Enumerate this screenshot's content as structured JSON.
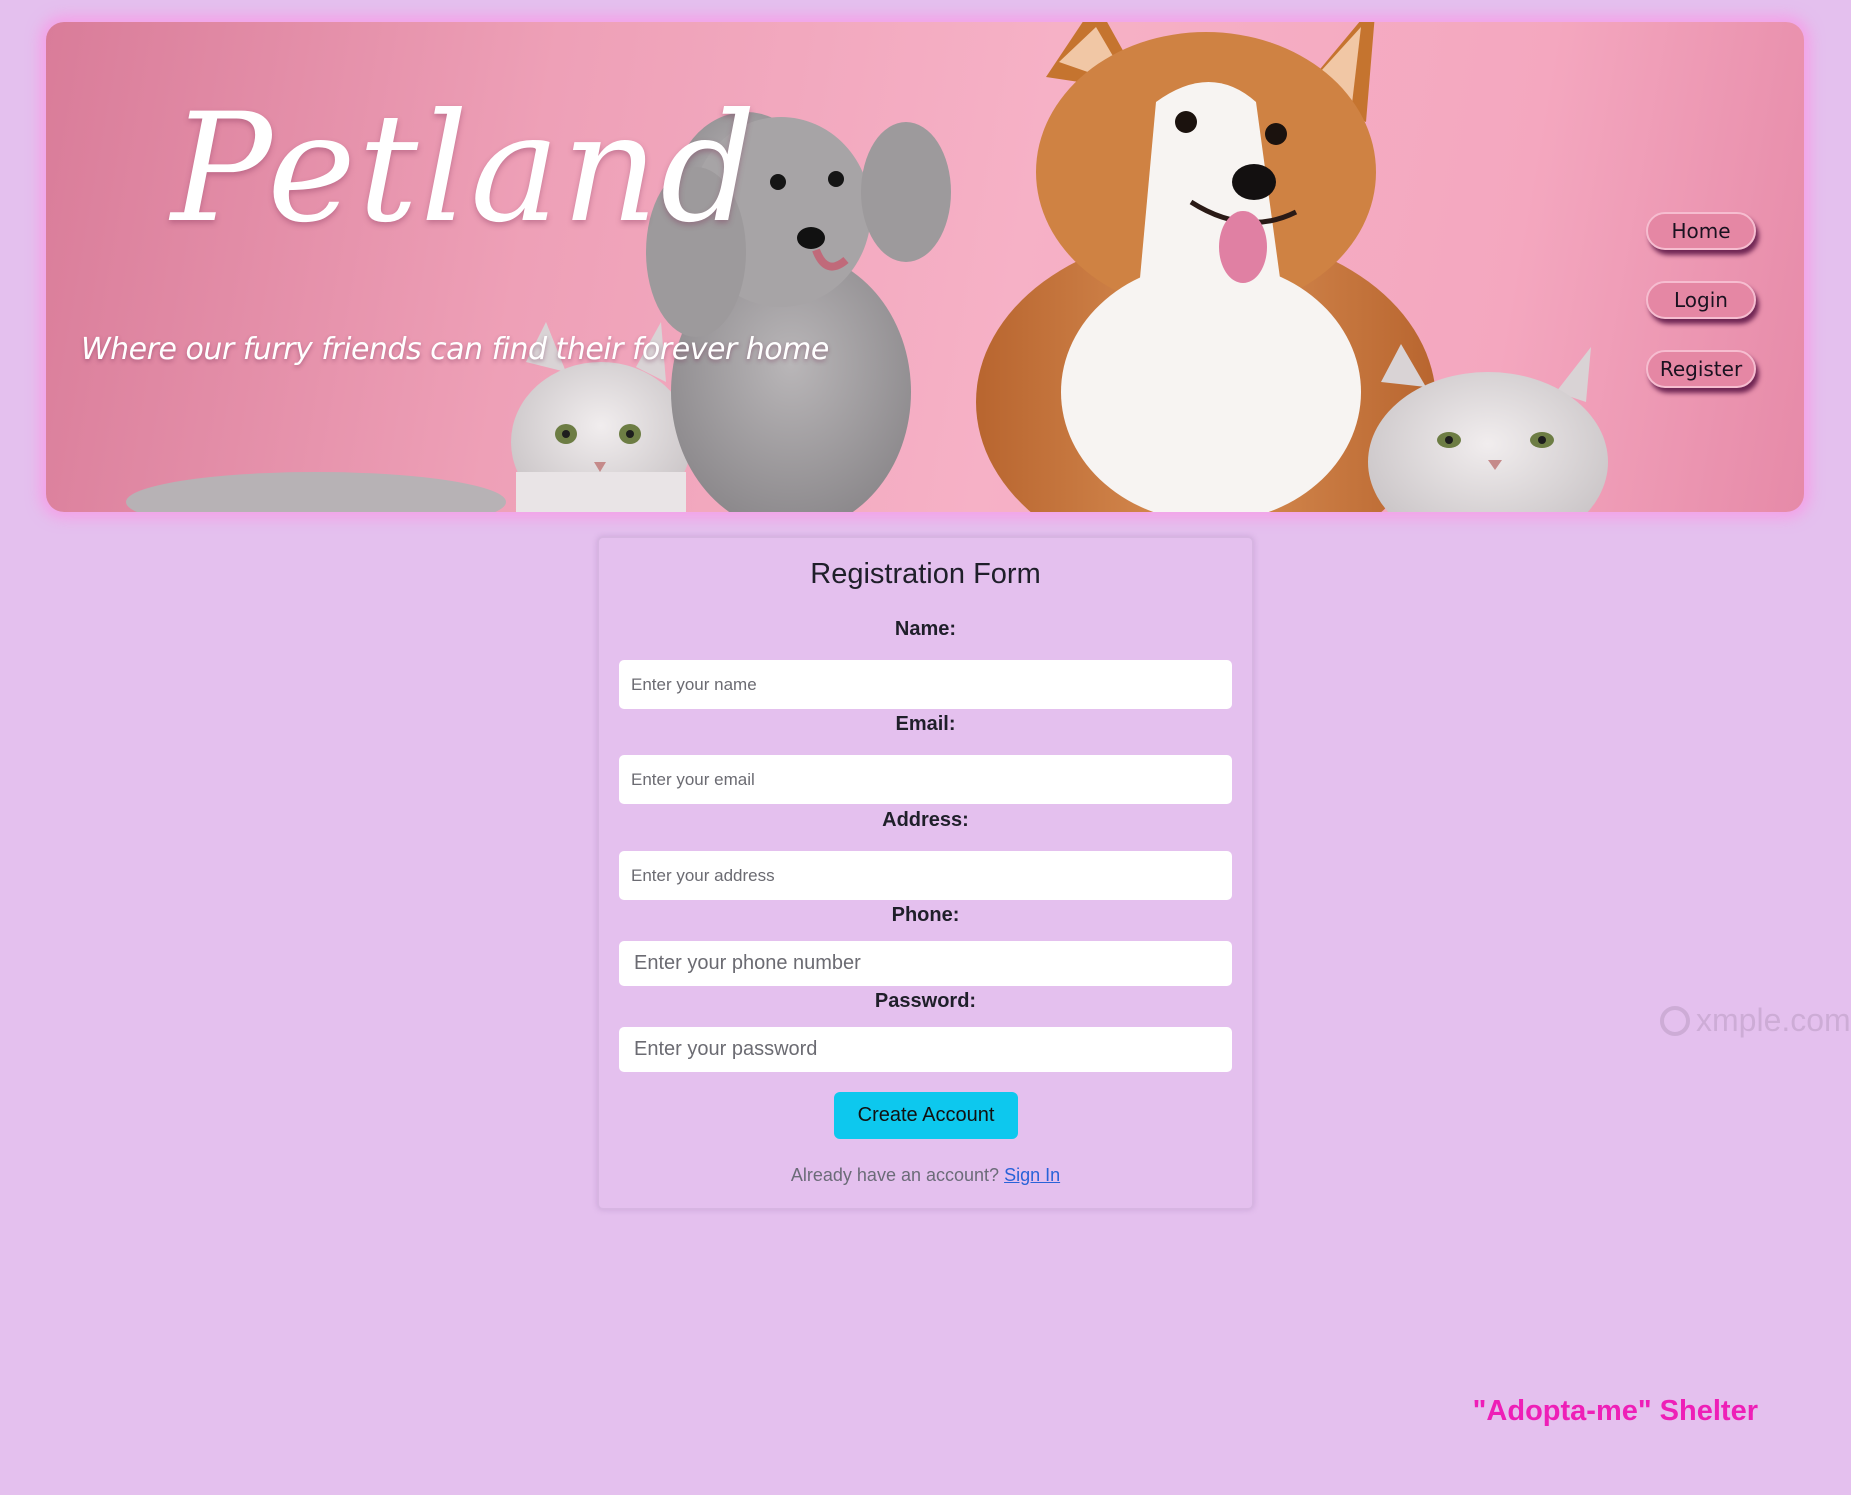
{
  "hero": {
    "title": "Petland",
    "tagline": "Where our furry friends can find their forever home"
  },
  "nav": {
    "home": "Home",
    "login": "Login",
    "register": "Register"
  },
  "form": {
    "title": "Registration Form",
    "name_label": "Name:",
    "name_placeholder": "Enter your name",
    "email_label": "Email:",
    "email_placeholder": "Enter your email",
    "address_label": "Address:",
    "address_placeholder": "Enter your address",
    "phone_label": "Phone:",
    "phone_placeholder": "Enter your phone number",
    "password_label": "Password:",
    "password_placeholder": "Enter your password",
    "submit_label": "Create Account",
    "signin_prompt": "Already have an account?",
    "signin_link": "Sign In"
  },
  "footer": {
    "shelter_name": "\"Adopta-me\" Shelter"
  },
  "watermark": {
    "text": "xmple.com"
  },
  "colors": {
    "page_background": "#e4c0ee",
    "banner_pink": "#f4a7bf",
    "submit_button": "#0dc8ee",
    "footer_accent": "#ee1fb7",
    "link": "#2862d8"
  }
}
